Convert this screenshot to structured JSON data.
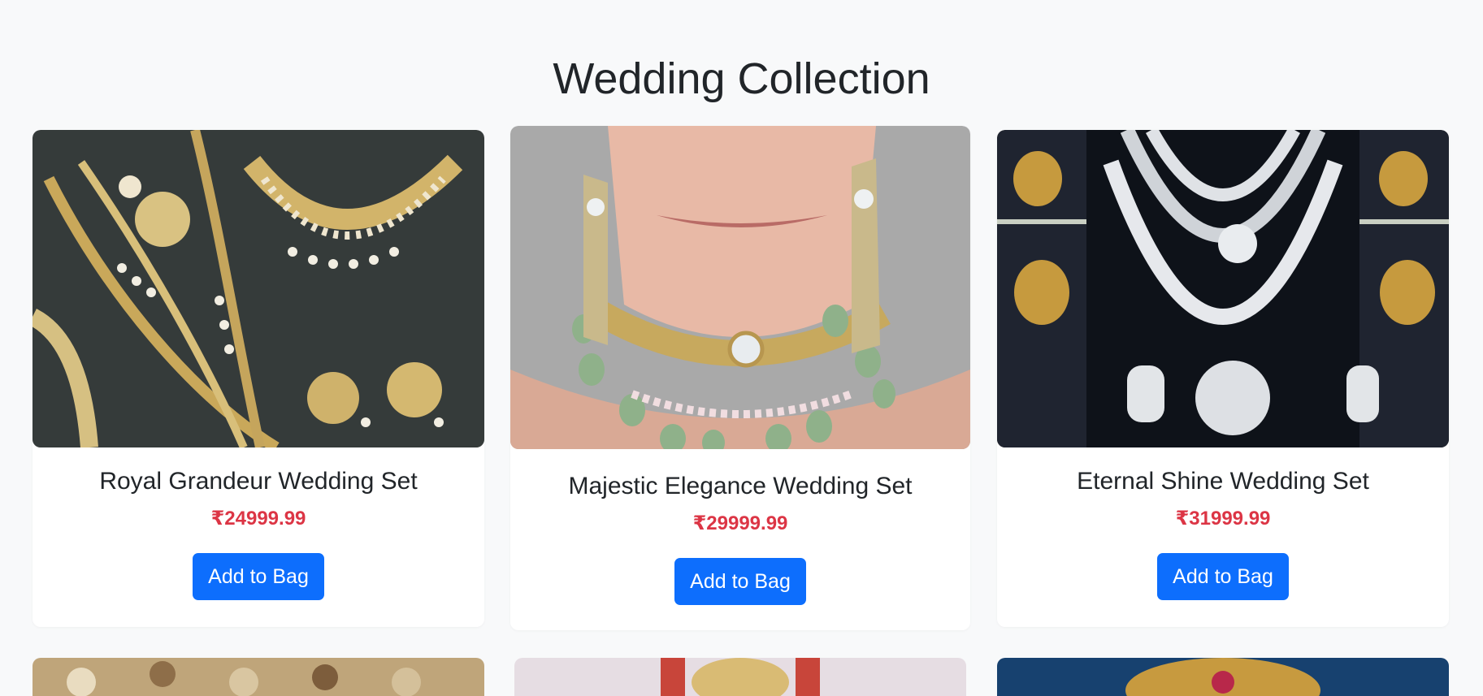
{
  "section": {
    "title": "Wedding Collection"
  },
  "products": [
    {
      "name": "Royal Grandeur Wedding Set",
      "price": "₹24999.99",
      "button_label": "Add to Bag",
      "image_alt": "Royal Grandeur Wedding Set"
    },
    {
      "name": "Majestic Elegance Wedding Set",
      "price": "₹29999.99",
      "button_label": "Add to Bag",
      "image_alt": "Majestic Elegance Wedding Set"
    },
    {
      "name": "Eternal Shine Wedding Set",
      "price": "₹31999.99",
      "button_label": "Add to Bag",
      "image_alt": "Eternal Shine Wedding Set"
    }
  ],
  "colors": {
    "page_background": "#f8f9fa",
    "card_background": "#ffffff",
    "price": "#dc3545",
    "button": "#0d6efd",
    "button_text": "#ffffff",
    "title_text": "#212529"
  }
}
